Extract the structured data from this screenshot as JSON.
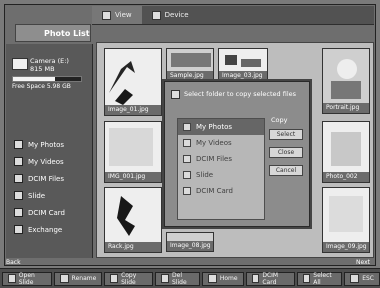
{
  "app": {
    "title": "Photo List",
    "tabs": [
      {
        "label": "View",
        "icon": "view-icon",
        "active": true
      },
      {
        "label": "Device",
        "icon": "device-icon",
        "active": false
      }
    ]
  },
  "device": {
    "name": "Camera (E:)",
    "sub": "815 MB",
    "storage_fraction": 0.62,
    "storage_text": "Free Space 5.98 GB"
  },
  "sidebar": {
    "items": [
      {
        "label": "My Photos",
        "icon": "photo-folder-icon"
      },
      {
        "label": "My Videos",
        "icon": "video-folder-icon"
      },
      {
        "label": "DCIM Files",
        "icon": "dcim-folder-icon"
      },
      {
        "label": "Slide",
        "icon": "slide-folder-icon"
      },
      {
        "label": "DCIM Card",
        "icon": "card-folder-icon"
      },
      {
        "label": "Exchange",
        "icon": "exchange-folder-icon"
      }
    ]
  },
  "thumbnails": [
    {
      "label": "Image_01.jpg"
    },
    {
      "label": "Sample.jpg"
    },
    {
      "label": "Image_03.jpg"
    },
    {
      "label": "Portrait.jpg"
    },
    {
      "label": "IMG_001.jpg"
    },
    {
      "label": "Photo_002"
    },
    {
      "label": "Rack.jpg"
    },
    {
      "label": "Image_08.jpg"
    },
    {
      "label": "Image_09.jpg"
    }
  ],
  "dialog": {
    "title": "Select folder to copy selected files",
    "list": [
      {
        "label": "My Photos",
        "selected": true
      },
      {
        "label": "My Videos",
        "selected": false
      },
      {
        "label": "DCIM Files",
        "selected": false
      },
      {
        "label": "Slide",
        "selected": false
      },
      {
        "label": "DCIM Card",
        "selected": false
      }
    ],
    "action_title": "Copy",
    "buttons": [
      "Select",
      "Close",
      "Cancel"
    ]
  },
  "bottom": {
    "left": "Back",
    "right": "Next"
  },
  "taskbar": {
    "items": [
      "Open Slide",
      "Rename",
      "Copy Slide",
      "Del Slide",
      "Home",
      "DCIM Card",
      "Select All",
      "ESC"
    ]
  }
}
